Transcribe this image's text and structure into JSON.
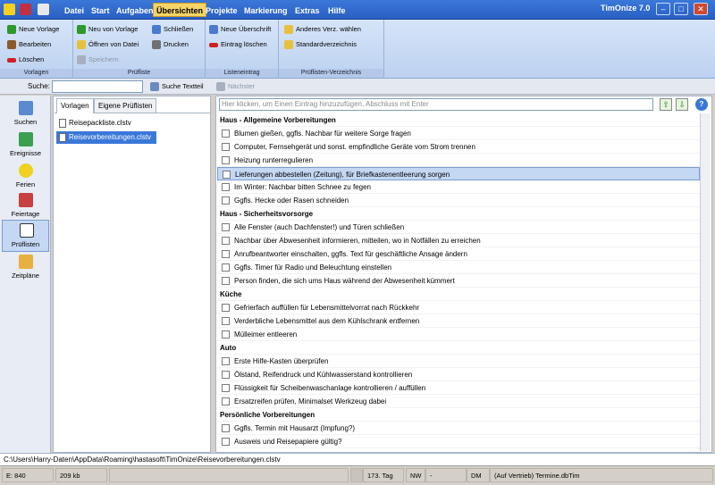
{
  "app_title": "TimOnize 7.0",
  "menu": [
    "Datei",
    "Start",
    "Aufgaben",
    "Übersichten",
    "Projekte",
    "Markierung",
    "Extras",
    "Hilfe"
  ],
  "ribbon": {
    "group1": {
      "label": "Vorlagen",
      "buttons": [
        "Neue Vorlage",
        "Bearbeiten",
        "Löschen"
      ]
    },
    "group2": {
      "label": "Prüfliste",
      "buttons": [
        "Neu von Vorlage",
        "Öffnen von Datei",
        "Speichern",
        "Schließen",
        "Drucken"
      ]
    },
    "group3": {
      "label": "Listeneintrag",
      "buttons": [
        "Neue Überschrift",
        "Eintrag löschen"
      ]
    },
    "group4": {
      "label": "Prüflisten-Verzeichnis",
      "buttons": [
        "Anderes Verz. wählen",
        "Standardverzeichnis"
      ]
    }
  },
  "search": {
    "label": "Suche:",
    "value": "",
    "search_text": "Suche Textteil",
    "next": "Nächster"
  },
  "sidebar": [
    "Suchen",
    "Ereignisse",
    "Ferien",
    "Feiertage",
    "Prüflisten",
    "Zeitpläne"
  ],
  "tabs": [
    "Vorlagen",
    "Eigene Prüflisten"
  ],
  "files": [
    "Reisepackliste.clstv",
    "Reisevorbereitungen.clstv"
  ],
  "entry_placeholder": "Hier klicken, um Einen Eintrag hinzuzufügen, Abschluss mit Enter",
  "rows": [
    {
      "type": "header",
      "text": "Haus - Allgemeine Vorbereitungen"
    },
    {
      "type": "item",
      "text": "Blumen gießen, ggfls. Nachbar für weitere Sorge fragen"
    },
    {
      "type": "item",
      "text": "Computer, Fernsehgerät und sonst. empfindliche Geräte vom Strom trennen"
    },
    {
      "type": "item",
      "text": "Heizung runterregulieren"
    },
    {
      "type": "item",
      "text": "Lieferungen abbestellen (Zeitung), für Briefkastenentleerung sorgen",
      "selected": true
    },
    {
      "type": "item",
      "text": "Im Winter: Nachbar bitten Schnee zu fegen"
    },
    {
      "type": "item",
      "text": "Ggfls. Hecke oder Rasen schneiden"
    },
    {
      "type": "header",
      "text": "Haus - Sicherheitsvorsorge"
    },
    {
      "type": "item",
      "text": "Alle Fenster (auch Dachfenster!) und Türen schließen"
    },
    {
      "type": "item",
      "text": "Nachbar über Abwesenheit informieren, mitteilen, wo in Notfällen zu erreichen"
    },
    {
      "type": "item",
      "text": "Anrufbeantworter einschalten, ggfls. Text für geschäftliche Ansage ändern"
    },
    {
      "type": "item",
      "text": "Ggfls. Timer für Radio und Beleuchtung einstellen"
    },
    {
      "type": "item",
      "text": "Person finden, die sich ums Haus während der Abwesenheit kümmert"
    },
    {
      "type": "header",
      "text": "Küche"
    },
    {
      "type": "item",
      "text": "Gefrierfach auffüllen für Lebensmittelvorrat nach Rückkehr"
    },
    {
      "type": "item",
      "text": "Verderbliche Lebensmittel aus dem Kühlschrank entfernen"
    },
    {
      "type": "item",
      "text": "Mülleimer entleeren"
    },
    {
      "type": "header",
      "text": "Auto"
    },
    {
      "type": "item",
      "text": "Erste Hilfe-Kasten überprüfen"
    },
    {
      "type": "item",
      "text": "Ölstand, Reifendruck und Kühlwasserstand kontrollieren"
    },
    {
      "type": "item",
      "text": "Flüssigkeit für Scheibenwaschanlage kontrollieren / auffüllen"
    },
    {
      "type": "item",
      "text": "Ersatzreifen prüfen, Minimalset Werkzeug dabei"
    },
    {
      "type": "header",
      "text": "Persönliche Vorbereitungen"
    },
    {
      "type": "item",
      "text": "Ggfls. Termin mit Hausarzt (Impfung?)"
    },
    {
      "type": "item",
      "text": "Ausweis und Reisepapiere gültig?"
    }
  ],
  "path": "C:\\Users\\Harry-Daten\\AppData\\Roaming\\hastasoft\\TimOnize\\Reisevorbereitungen.clstv",
  "status": [
    "E: 840",
    "209 kb",
    "173. Tag",
    "NW",
    "-",
    "DM",
    "(Auf Vertrieb) Termine.dbTim"
  ]
}
